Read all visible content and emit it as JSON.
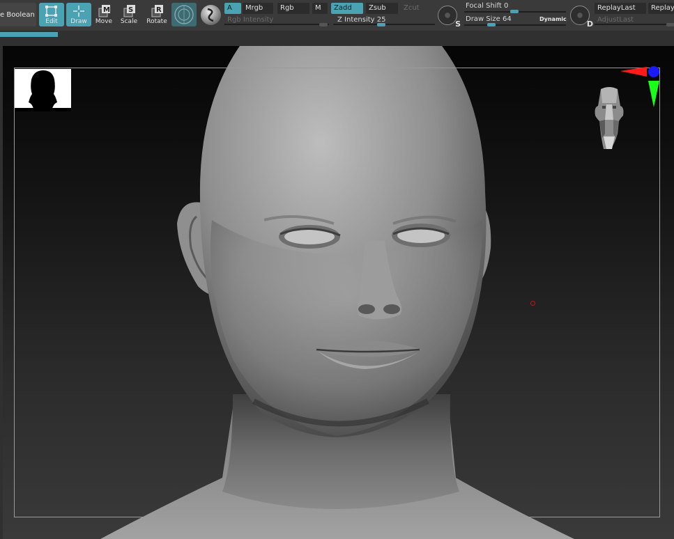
{
  "toolbar": {
    "boolean_label": "e Boolean",
    "tools": {
      "edit": "Edit",
      "draw": "Draw",
      "move": "Move",
      "scale": "Scale",
      "rotate": "Rotate"
    },
    "tool_keys": {
      "move": "M",
      "scale": "S",
      "rotate": "R"
    },
    "color_modes": {
      "a": "A",
      "mrgb": "Mrgb",
      "rgb": "Rgb",
      "m": "M"
    },
    "rgb_intensity_label": "Rgb Intensity",
    "depth_modes": {
      "zadd": "Zadd",
      "zsub": "Zsub",
      "zcut": "Zcut"
    },
    "z_intensity": {
      "label": "Z Intensity",
      "value": "25"
    },
    "focal_shift": {
      "label": "Focal Shift",
      "value": "0"
    },
    "draw_size": {
      "label": "Draw Size",
      "value": "64"
    },
    "dynamic_label": "Dynamic",
    "stroke_letter": "S",
    "lightbox_letter": "D",
    "replay_last": "ReplayLast",
    "replay": "Replay",
    "adjust_last": "AdjustLast",
    "accent_color": "#4aa3b2"
  },
  "icons": {
    "edit": "edit-icon",
    "draw": "draw-icon",
    "move": "move-icon",
    "scale": "scale-icon",
    "rotate": "rotate-icon",
    "rgb_ball": "rgb-material-icon",
    "sphere": "material-sphere-icon",
    "stroke": "stroke-icon",
    "alpha": "alpha-icon"
  }
}
